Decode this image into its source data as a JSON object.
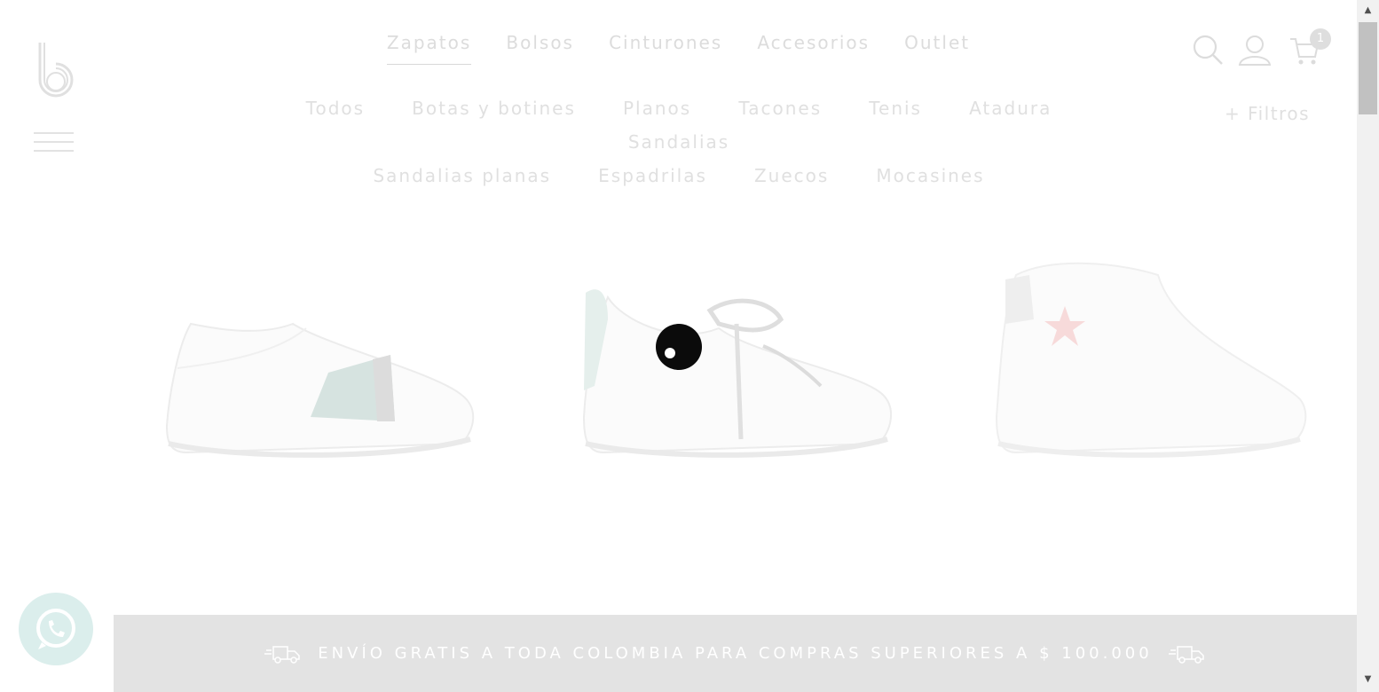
{
  "header": {
    "logo_alt": "b",
    "nav": [
      {
        "label": "Zapatos",
        "active": true
      },
      {
        "label": "Bolsos"
      },
      {
        "label": "Cinturones"
      },
      {
        "label": "Accesorios"
      },
      {
        "label": "Outlet"
      }
    ],
    "cart_count": "1",
    "icons": [
      "search-icon",
      "user-icon",
      "cart-icon"
    ]
  },
  "categories": {
    "row1": [
      "Todos",
      "Botas y botines",
      "Planos",
      "Tacones",
      "Tenis",
      "Atadura",
      "Sandalias"
    ],
    "row2": [
      "Sandalias planas",
      "Espadrilas",
      "Zuecos",
      "Mocasines"
    ],
    "filters_label": "+ Filtros"
  },
  "banner": {
    "text": "ENVÍO GRATIS A TODA COLOMBIA PARA COMPRAS SUPERIORES A $ 100.000"
  },
  "colors": {
    "nav_text": "#dcdcdc",
    "banner_bg": "#e3e3e3",
    "whatsapp_bg": "#dbeeec",
    "loader": "#0b0b0b"
  }
}
